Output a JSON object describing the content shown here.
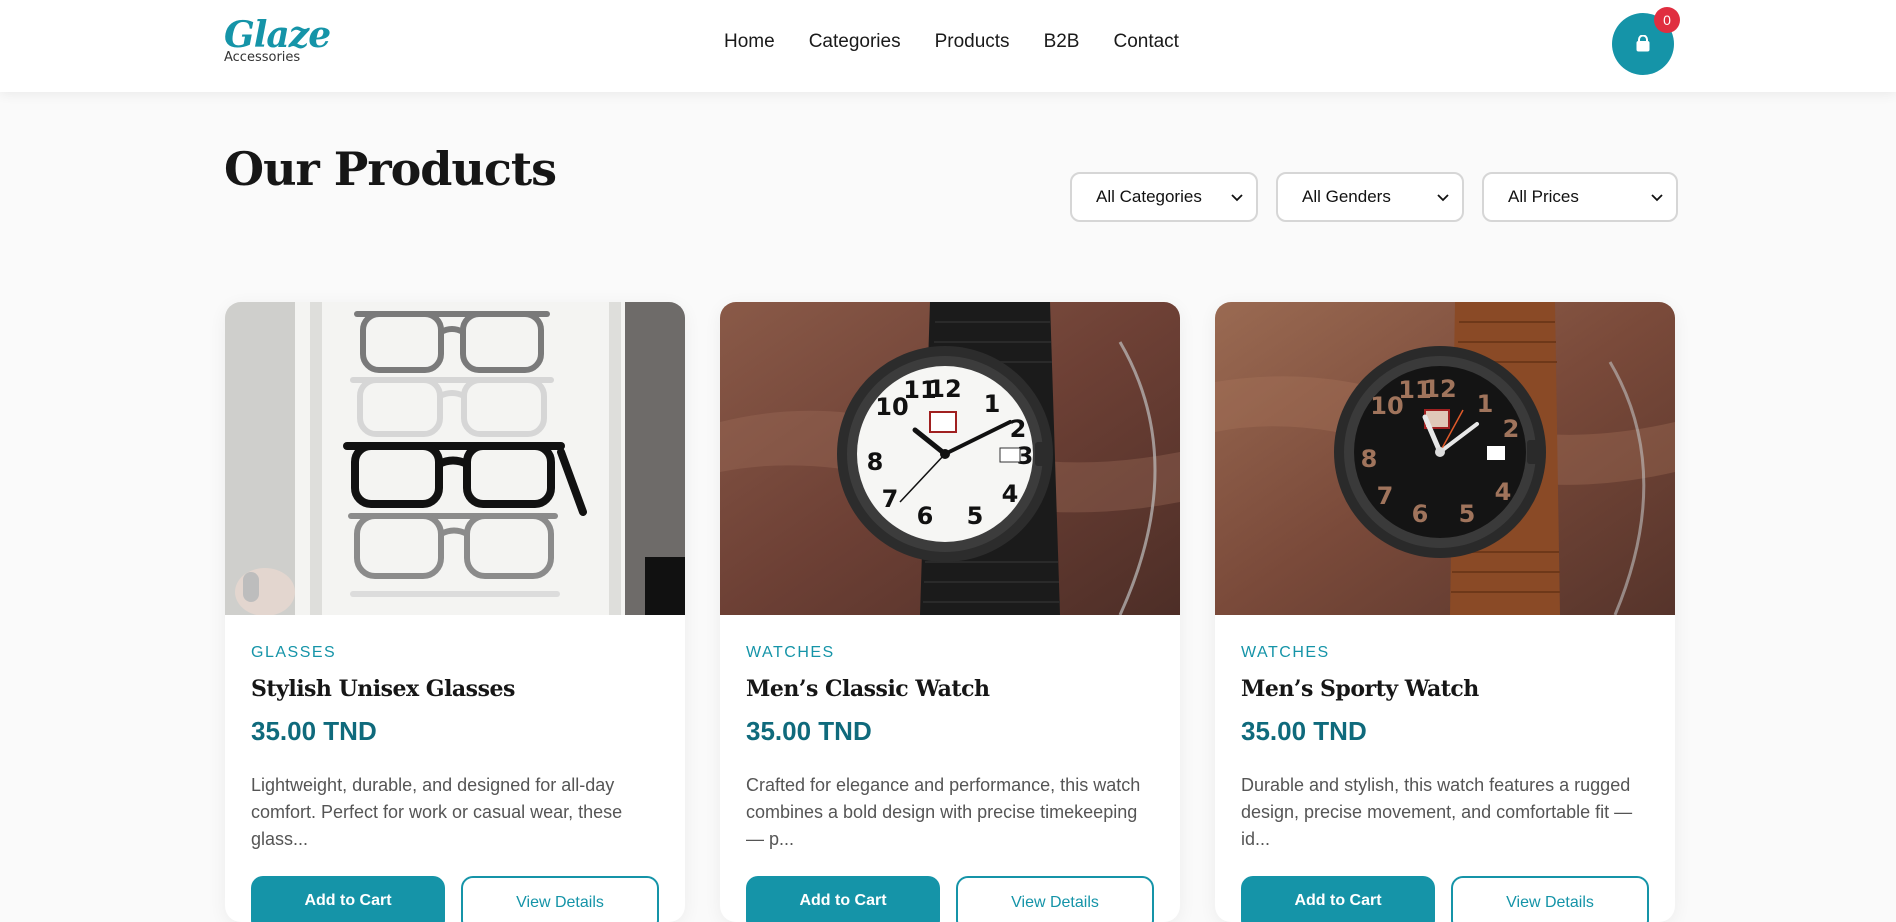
{
  "brand": {
    "logo_text": "Glaze",
    "logo_sub": "Accessories",
    "accent": "#1594a8",
    "badge_color": "#e02e40"
  },
  "nav": {
    "items": [
      {
        "label": "Home"
      },
      {
        "label": "Categories"
      },
      {
        "label": "Products"
      },
      {
        "label": "B2B"
      },
      {
        "label": "Contact"
      }
    ]
  },
  "cart": {
    "count": "0",
    "icon": "shopping-bag-icon"
  },
  "main": {
    "title": "Our Products",
    "filters": [
      {
        "value": "All Categories"
      },
      {
        "value": "All Genders"
      },
      {
        "value": "All Prices"
      }
    ]
  },
  "products": [
    {
      "category": "GLASSES",
      "name": "Stylish Unisex Glasses",
      "price": "35.00 TND",
      "description": "Lightweight, durable, and designed for all-day comfort. Perfect for work or casual wear, these glass...",
      "add_label": "Add to Cart",
      "view_label": "View Details",
      "image": "glasses-photo"
    },
    {
      "category": "WATCHES",
      "name": "Men’s Classic Watch",
      "price": "35.00 TND",
      "description": "Crafted for elegance and performance, this watch combines a bold design with precise timekeeping — p...",
      "add_label": "Add to Cart",
      "view_label": "View Details",
      "image": "classic-watch-photo"
    },
    {
      "category": "WATCHES",
      "name": "Men’s Sporty Watch",
      "price": "35.00 TND",
      "description": "Durable and stylish, this watch features a rugged design, precise movement, and comfortable fit — id...",
      "add_label": "Add to Cart",
      "view_label": "View Details",
      "image": "sporty-watch-photo"
    }
  ]
}
